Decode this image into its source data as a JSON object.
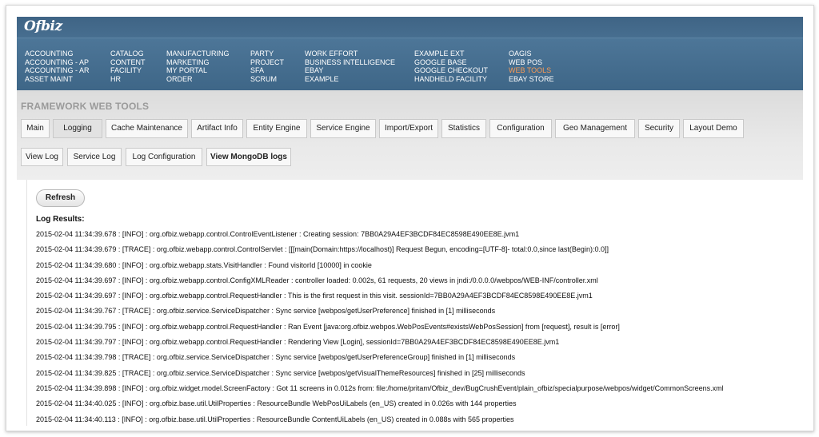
{
  "app": {
    "logo_text": "Ofbiz"
  },
  "menu": {
    "columns": [
      {
        "items": [
          "ACCOUNTING",
          "ACCOUNTING - AP",
          "ACCOUNTING - AR",
          "ASSET MAINT"
        ]
      },
      {
        "items": [
          "CATALOG",
          "CONTENT",
          "FACILITY",
          "HR"
        ]
      },
      {
        "items": [
          "MANUFACTURING",
          "MARKETING",
          "MY PORTAL",
          "ORDER"
        ]
      },
      {
        "items": [
          "PARTY",
          "PROJECT",
          "SFA",
          "SCRUM"
        ]
      },
      {
        "items": [
          "WORK EFFORT",
          "BUSINESS INTELLIGENCE",
          "EBAY",
          "EXAMPLE"
        ]
      },
      {
        "items": [
          "EXAMPLE EXT",
          "GOOGLE BASE",
          "GOOGLE CHECKOUT",
          "HANDHELD FACILITY"
        ]
      },
      {
        "items": [
          "OAGIS",
          "WEB POS",
          "WEB TOOLS",
          "EBAY STORE"
        ]
      }
    ],
    "active_item": "WEB TOOLS",
    "active_color": "#f79a55"
  },
  "page": {
    "title": "FRAMEWORK WEB TOOLS"
  },
  "tabs": {
    "items": [
      "Main",
      "Logging",
      "Cache Maintenance",
      "Artifact Info",
      "Entity Engine",
      "Service Engine",
      "Import/Export",
      "Statistics",
      "Configuration",
      "Geo Management",
      "Security",
      "Layout Demo"
    ],
    "selected": "Logging"
  },
  "subtabs": {
    "items": [
      "View Log",
      "Service Log",
      "Log Configuration",
      "View MongoDB logs"
    ]
  },
  "content": {
    "refresh_label": "Refresh",
    "log_heading": "Log Results:",
    "log_lines": [
      "2015-02-04 11:34:39.678 : [INFO] : org.ofbiz.webapp.control.ControlEventListener : Creating session: 7BB0A29A4EF3BCDF84EC8598E490EE8E.jvm1",
      "2015-02-04 11:34:39.679 : [TRACE] : org.ofbiz.webapp.control.ControlServlet : [[[main(Domain:https://localhost)] Request Begun, encoding=[UTF-8]- total:0.0,since last(Begin):0.0]]",
      "2015-02-04 11:34:39.680 : [INFO] : org.ofbiz.webapp.stats.VisitHandler : Found visitorId [10000] in cookie",
      "2015-02-04 11:34:39.697 : [INFO] : org.ofbiz.webapp.control.ConfigXMLReader : controller loaded: 0.002s, 61 requests, 20 views in jndi:/0.0.0.0/webpos/WEB-INF/controller.xml",
      "2015-02-04 11:34:39.697 : [INFO] : org.ofbiz.webapp.control.RequestHandler : This is the first request in this visit. sessionId=7BB0A29A4EF3BCDF84EC8598E490EE8E.jvm1",
      "2015-02-04 11:34:39.767 : [TRACE] : org.ofbiz.service.ServiceDispatcher : Sync service [webpos/getUserPreference] finished in [1] milliseconds",
      "2015-02-04 11:34:39.795 : [INFO] : org.ofbiz.webapp.control.RequestHandler : Ran Event [java:org.ofbiz.webpos.WebPosEvents#existsWebPosSession] from [request], result is [error]",
      "2015-02-04 11:34:39.797 : [INFO] : org.ofbiz.webapp.control.RequestHandler : Rendering View [Login], sessionId=7BB0A29A4EF3BCDF84EC8598E490EE8E.jvm1",
      "2015-02-04 11:34:39.798 : [TRACE] : org.ofbiz.service.ServiceDispatcher : Sync service [webpos/getUserPreferenceGroup] finished in [1] milliseconds",
      "2015-02-04 11:34:39.825 : [TRACE] : org.ofbiz.service.ServiceDispatcher : Sync service [webpos/getVisualThemeResources] finished in [25] milliseconds",
      "2015-02-04 11:34:39.898 : [INFO] : org.ofbiz.widget.model.ScreenFactory : Got 11 screens in 0.012s from: file:/home/pritam/Ofbiz_dev/BugCrushEvent/plain_ofbiz/specialpurpose/webpos/widget/CommonScreens.xml",
      "2015-02-04 11:34:40.025 : [INFO] : org.ofbiz.base.util.UtilProperties : ResourceBundle WebPosUiLabels (en_US) created in 0.026s with 144 properties",
      "2015-02-04 11:34:40.113 : [INFO] : org.ofbiz.base.util.UtilProperties : ResourceBundle ContentUiLabels (en_US) created in 0.088s with 565 properties"
    ]
  }
}
